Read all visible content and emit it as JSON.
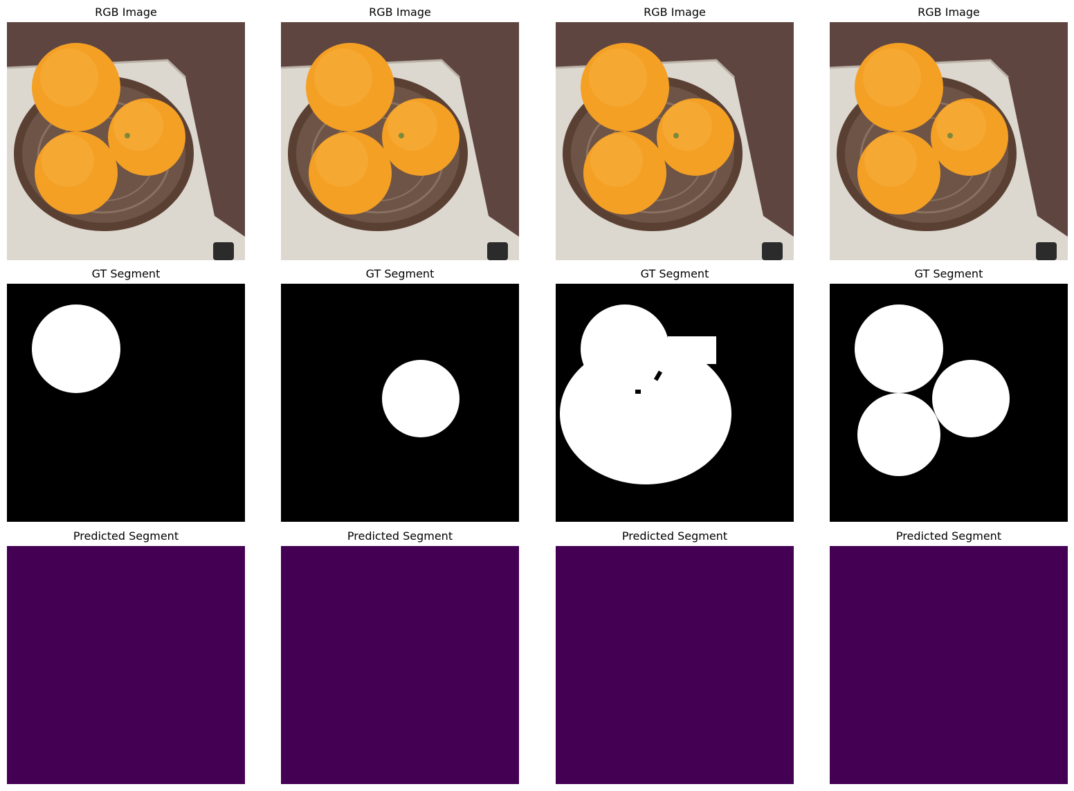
{
  "rows": [
    {
      "title": "RGB Image",
      "kind": "rgb"
    },
    {
      "title": "GT Segment",
      "kind": "gt"
    },
    {
      "title": "Predicted Segment",
      "kind": "pred"
    }
  ],
  "columns": 4,
  "colors": {
    "background": "#ffffff",
    "mask_on": "#ffffff",
    "mask_off": "#000000",
    "prediction_fill": "#440154",
    "wood": "#5e4540",
    "counter": "#ddd8cf",
    "bowl": "#6e5446",
    "orange": "#f4a025"
  }
}
